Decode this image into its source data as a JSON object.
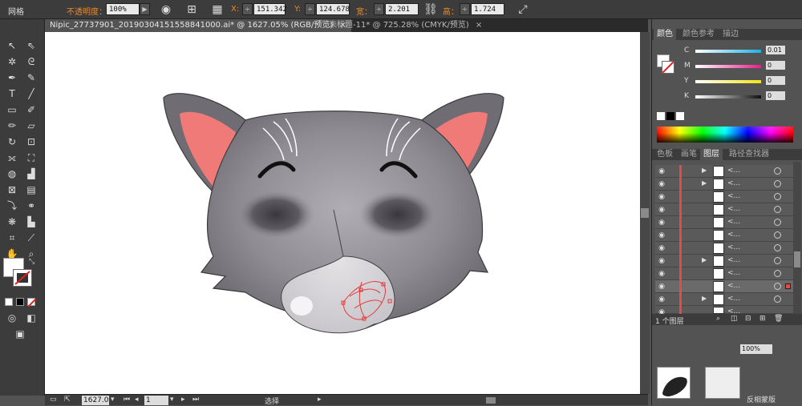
{
  "control_bar": {
    "mode_label": "网格",
    "opacity_label": "不透明度：",
    "opacity_value": "100%",
    "x_label": "X:",
    "x_value": "151.342 m",
    "y_label": "Y:",
    "y_value": "124.678 m",
    "width_label": "宽：",
    "width_value": "2.201 mm",
    "height_label": "高：",
    "height_value": "1.724 mm"
  },
  "tabs": [
    {
      "label": "Nipic_27737901_20190304151558841000.ai* @ 1627.05% (RGB/预览)",
      "close": "×"
    },
    {
      "label": "未标题-11* @ 725.28% (CMYK/预览)",
      "close": "×"
    }
  ],
  "status_bar": {
    "zoom": "1627.0",
    "page": "1",
    "tool": "选择"
  },
  "color_panel": {
    "tabs": [
      "颜色",
      "颜色参考",
      "描边"
    ],
    "channels": [
      {
        "label": "C",
        "value": "0.01"
      },
      {
        "label": "M",
        "value": "0"
      },
      {
        "label": "Y",
        "value": "0"
      },
      {
        "label": "K",
        "value": "0"
      }
    ],
    "colors": {
      "cyan": "#19b4e6",
      "magenta": "#e61e8c",
      "yellow": "#f0e614",
      "black": "#111111"
    }
  },
  "layers_panel": {
    "tabs": [
      "色板",
      "画笔",
      "图层",
      "路径查找器"
    ],
    "rows": [
      {
        "name": "<...",
        "expand": true
      },
      {
        "name": "<...",
        "expand": true
      },
      {
        "name": "<...",
        "expand": false
      },
      {
        "name": "<...",
        "expand": false
      },
      {
        "name": "<...",
        "expand": false
      },
      {
        "name": "<...",
        "expand": false
      },
      {
        "name": "<...",
        "expand": false
      },
      {
        "name": "<...",
        "expand": true
      },
      {
        "name": "<...",
        "expand": false
      },
      {
        "name": "<...",
        "expand": false
      },
      {
        "name": "<...",
        "expand": true
      },
      {
        "name": "<...",
        "expand": false
      }
    ],
    "footer": "1 个图层"
  },
  "transparency_panel": {
    "opacity": "100%",
    "invert_mask": "反相蒙版"
  },
  "icons": {
    "eye": "◉",
    "expand": "▶",
    "dropdown": "▾",
    "link": "⛓",
    "arrow": "▸"
  }
}
